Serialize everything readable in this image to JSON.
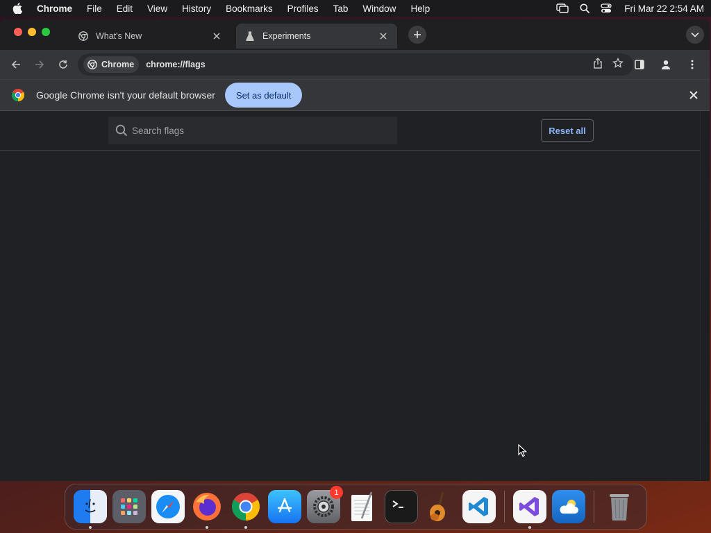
{
  "menubar": {
    "app_name": "Chrome",
    "items": [
      "File",
      "Edit",
      "View",
      "History",
      "Bookmarks",
      "Profiles",
      "Tab",
      "Window",
      "Help"
    ],
    "clock": "Fri Mar 22  2:54 AM"
  },
  "tabs": [
    {
      "title": "What's New",
      "icon": "chrome-icon",
      "active": false
    },
    {
      "title": "Experiments",
      "icon": "flask-icon",
      "active": true
    }
  ],
  "omnibox": {
    "chip_label": "Chrome",
    "url": "chrome://flags"
  },
  "infobar": {
    "message": "Google Chrome isn't your default browser",
    "button_label": "Set as default"
  },
  "flags_page": {
    "search_placeholder": "Search flags",
    "reset_label": "Reset all"
  },
  "dock": {
    "apps": [
      "Finder",
      "Launchpad",
      "Safari",
      "Firefox",
      "Chrome",
      "App Store",
      "System Settings",
      "TextEdit",
      "Terminal",
      "GarageBand",
      "Visual Studio Code",
      "Visual Studio",
      "Weather",
      "Trash"
    ],
    "system_settings_badge": "1"
  },
  "colors": {
    "accent_button": "#a8c7fa",
    "link_blue": "#8ab4f8",
    "page_bg": "#202124"
  }
}
